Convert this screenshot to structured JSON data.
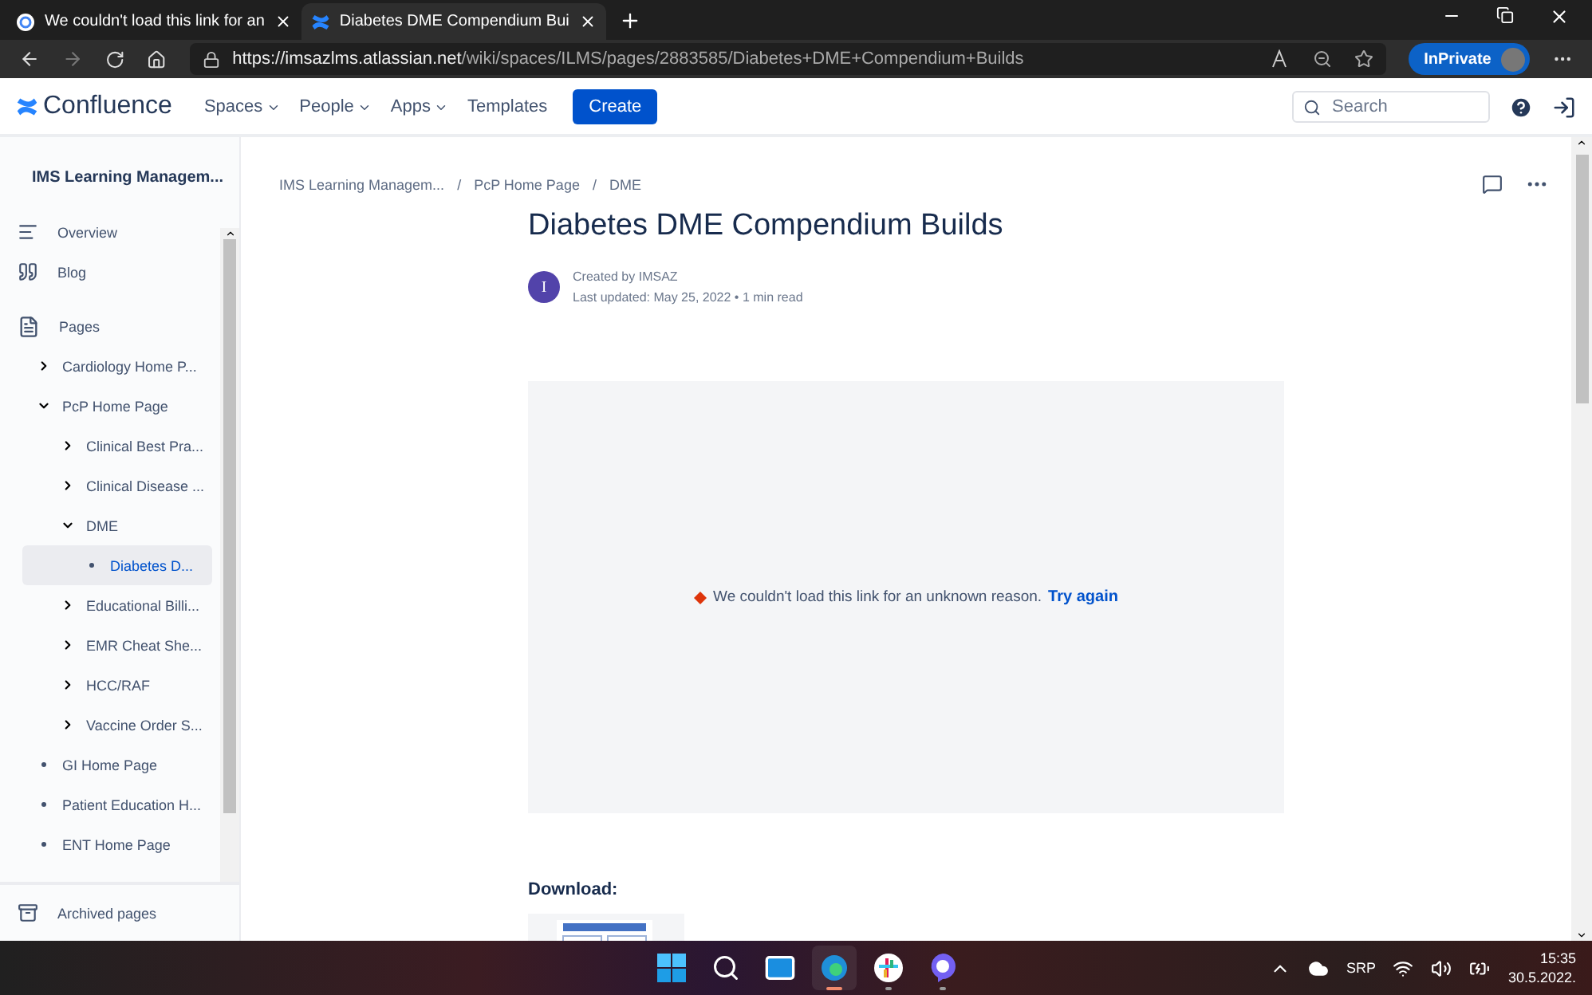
{
  "browser": {
    "tabs": [
      {
        "title": "We couldn't load this link for an",
        "selected": false,
        "kind": "google"
      },
      {
        "title": "Diabetes DME Compendium Bui",
        "selected": true,
        "kind": "confluence"
      }
    ],
    "url": {
      "host": "https://imsazlms.atlassian.net",
      "path": "/wiki/spaces/ILMS/pages/2883585/Diabetes+DME+Compendium+Builds"
    },
    "profile_label": "InPrivate"
  },
  "header": {
    "logo": "Confluence",
    "nav": [
      {
        "label": "Spaces",
        "dropdown": true
      },
      {
        "label": "People",
        "dropdown": true
      },
      {
        "label": "Apps",
        "dropdown": true
      },
      {
        "label": "Templates",
        "dropdown": false
      }
    ],
    "create_button": "Create",
    "search": {
      "placeholder": "Search"
    }
  },
  "sidebar": {
    "space_name": "IMS Learning Managem...",
    "nav": [
      {
        "label": "Overview",
        "kind": "overview"
      },
      {
        "label": "Blog",
        "kind": "blog"
      },
      {
        "label": "Pages",
        "kind": "pages"
      }
    ],
    "tree": [
      {
        "label": "Cardiology Home P...",
        "kind": "folder",
        "expanded": false,
        "selected": false
      },
      {
        "label": "PcP Home Page",
        "kind": "folder",
        "expanded": true,
        "selected": false,
        "children": [
          {
            "label": "Clinical Best Pra...",
            "kind": "folder",
            "expanded": false,
            "selected": false
          },
          {
            "label": "Clinical Disease ...",
            "kind": "folder",
            "expanded": false,
            "selected": false
          },
          {
            "label": "DME",
            "kind": "folder",
            "expanded": true,
            "selected": false,
            "children": [
              {
                "label": "Diabetes D...",
                "kind": "leaf",
                "selected": true
              }
            ]
          },
          {
            "label": "Educational Billi...",
            "kind": "folder",
            "expanded": false,
            "selected": false
          },
          {
            "label": "EMR Cheat She...",
            "kind": "folder",
            "expanded": false,
            "selected": false
          },
          {
            "label": "HCC/RAF",
            "kind": "folder",
            "expanded": false,
            "selected": false
          },
          {
            "label": "Vaccine Order S...",
            "kind": "folder",
            "expanded": false,
            "selected": false
          }
        ]
      },
      {
        "label": "GI Home Page",
        "kind": "leaf",
        "selected": false
      },
      {
        "label": "Patient Education H...",
        "kind": "leaf",
        "selected": false
      },
      {
        "label": "ENT Home Page",
        "kind": "leaf",
        "selected": false
      }
    ],
    "archived": "Archived pages"
  },
  "page": {
    "breadcrumbs": [
      "IMS Learning Managem...",
      "PcP Home Page",
      "DME"
    ],
    "breadcrumb_separator": "/",
    "meta_separator": "•",
    "title": "Diabetes DME Compendium Builds",
    "author_initial": "I",
    "created_by": "Created by IMSAZ",
    "last_updated": "Last updated: May 25, 2022",
    "read_time": "1 min read",
    "embed": {
      "error": "We couldn't load this link for an unknown reason.",
      "retry": "Try again"
    },
    "download_heading": "Download:"
  },
  "taskbar": {
    "language": "SRP",
    "time": "15:35",
    "date": "30.5.2022.",
    "apps": [
      {
        "kind": "start",
        "active": false
      },
      {
        "kind": "search",
        "active": false
      },
      {
        "kind": "mail",
        "active": false
      },
      {
        "kind": "browser",
        "active": true
      },
      {
        "kind": "chat",
        "active": false
      },
      {
        "kind": "phone",
        "active": false
      }
    ]
  }
}
